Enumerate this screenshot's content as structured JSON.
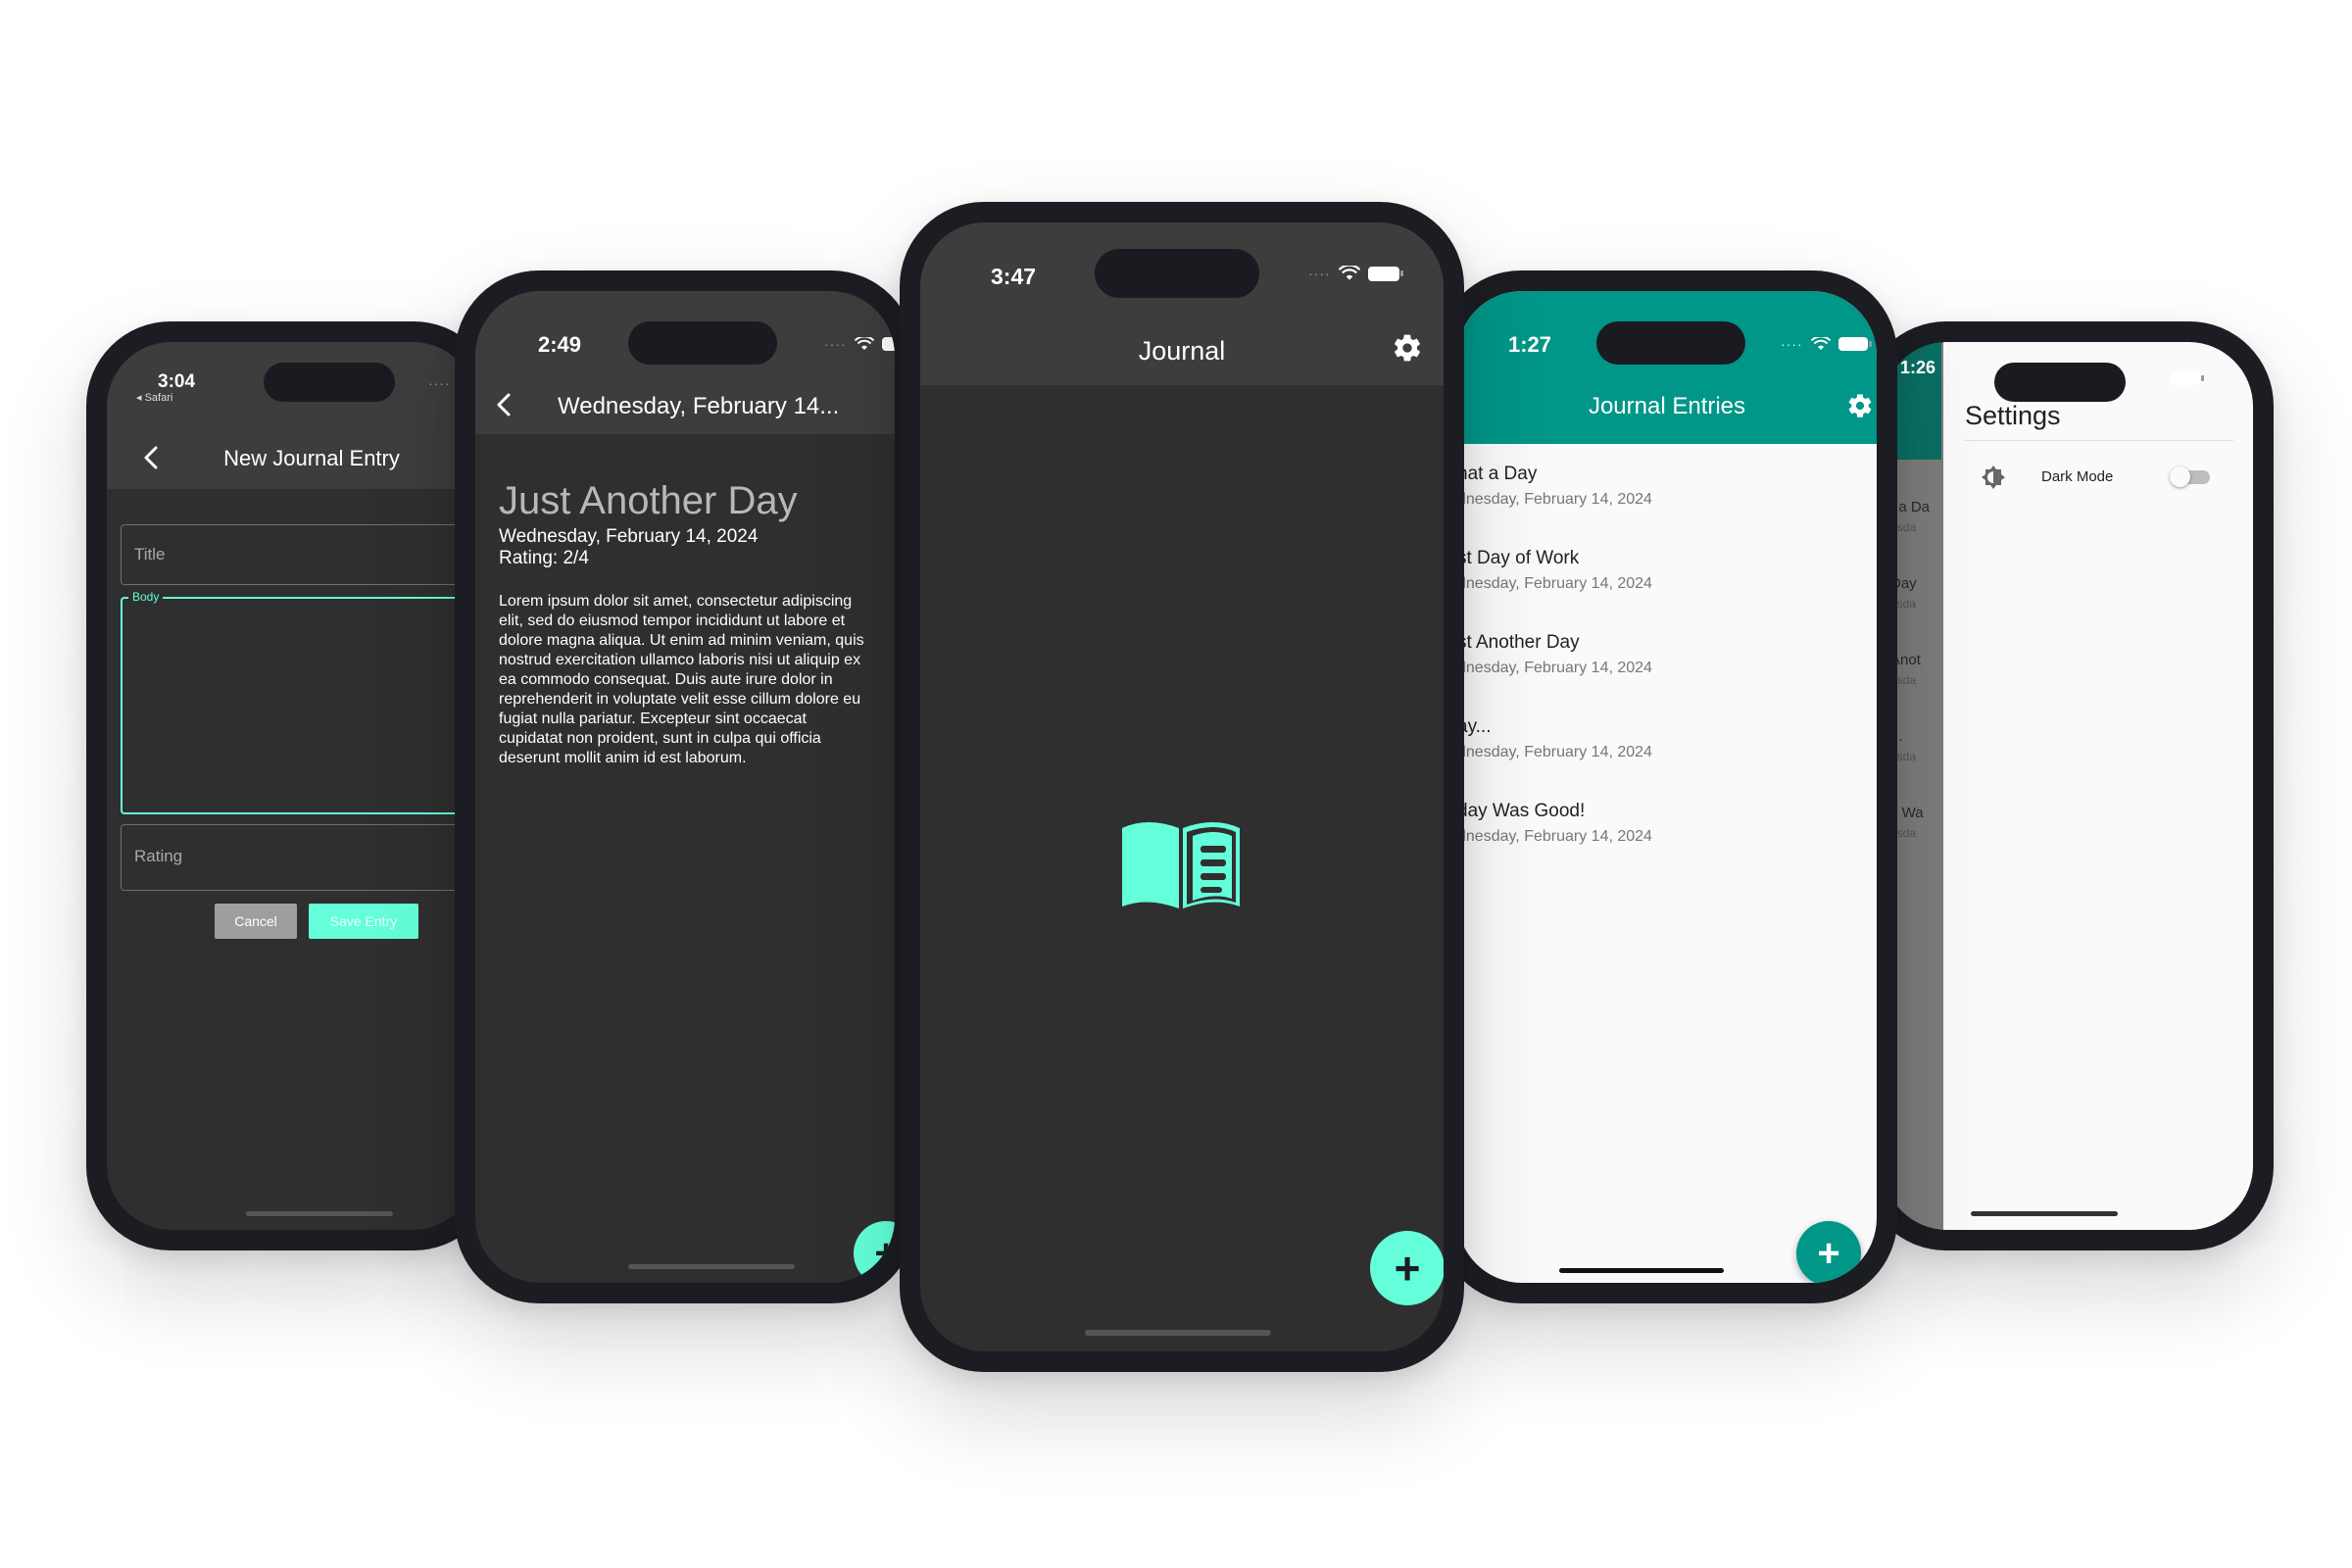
{
  "colors": {
    "accent": "#64ffda",
    "teal": "#009688",
    "dark_bg": "#2f2f2f",
    "appbar_dark": "#3d3d3d"
  },
  "phone1": {
    "status_time": "3:04",
    "back_app": "◂ Safari",
    "title": "New Journal Entry",
    "back_icon": "chevron-left-icon",
    "title_placeholder": "Title",
    "body_label": "Body",
    "rating_placeholder": "Rating",
    "cancel_label": "Cancel",
    "save_label": "Save Entry"
  },
  "phone2": {
    "status_time": "2:49",
    "title": "Wednesday, February 14...",
    "entry_title": "Just Another Day",
    "entry_date": "Wednesday, February 14, 2024",
    "entry_rating": "Rating: 2/4",
    "body_lines": [
      "Lorem ipsum dolor sit amet, consectetur adipiscing",
      "elit, sed do eiusmod tempor incididunt ut labore et",
      "dolore magna aliqua. Ut enim ad minim veniam, quis",
      "nostrud exercitation ullamco laboris nisi ut aliquip ex",
      "ea commodo consequat. Duis aute irure dolor in",
      "reprehenderit in voluptate velit esse cillum dolore eu",
      "fugiat nulla pariatur. Excepteur sint occaecat",
      "cupidatat non proident, sunt in culpa qui officia",
      "deserunt mollit anim id est laborum."
    ],
    "fab_label": "+"
  },
  "phone3": {
    "status_time": "3:47",
    "title": "Journal",
    "settings_icon": "gear-icon",
    "center_icon": "open-book-icon",
    "fab_label": "+"
  },
  "phone4": {
    "status_time": "1:27",
    "title": "Journal Entries",
    "entries": [
      {
        "title": "hat a Day",
        "date": "dnesday, February 14, 2024"
      },
      {
        "title": "st Day of Work",
        "date": "dnesday, February 14, 2024"
      },
      {
        "title": "st Another Day",
        "date": "dnesday, February 14, 2024"
      },
      {
        "title": "ay...",
        "date": "dnesday, February 14, 2024"
      },
      {
        "title": "day Was Good!",
        "date": "dnesday, February 14, 2024"
      }
    ],
    "fab_label": "+"
  },
  "phone5": {
    "status_time": "1:26",
    "title": "Settings",
    "dark_mode_label": "Dark Mode",
    "dark_mode_on": false,
    "theme_icon": "brightness-icon",
    "peek_lines": [
      "t a Da",
      "esda",
      "Day",
      "esda",
      "Anot",
      "esda",
      "...",
      "esda",
      "y Wa",
      "esda"
    ]
  }
}
